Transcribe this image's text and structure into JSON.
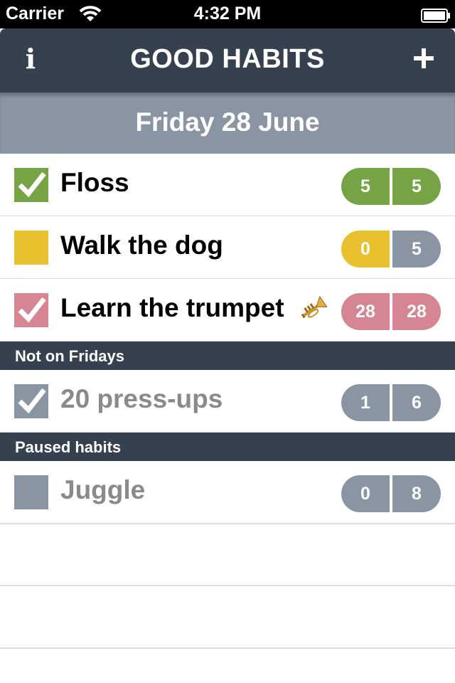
{
  "status_bar": {
    "carrier": "Carrier",
    "time": "4:32 PM"
  },
  "nav": {
    "title": "GOOD HABITS",
    "info_label": "i",
    "add_icon": "plus-icon",
    "info_icon": "info-icon"
  },
  "date_label": "Friday 28 June",
  "colors": {
    "dark": "#36414f",
    "date_bar": "#8a95a4",
    "green": "#76a445",
    "yellow": "#e9c12e",
    "pink": "#d68692",
    "gray": "#8a95a4"
  },
  "today_habits": [
    {
      "name": "Floss",
      "checked": true,
      "color": "green",
      "left_value": "5",
      "right_value": "5",
      "left_color": "green",
      "right_color": "green"
    },
    {
      "name": "Walk the dog",
      "checked": false,
      "color": "yellow",
      "left_value": "0",
      "right_value": "5",
      "left_color": "yellow",
      "right_color": "gray"
    },
    {
      "name": "Learn the trumpet",
      "checked": true,
      "color": "pink",
      "icon": "trumpet-icon",
      "left_value": "28",
      "right_value": "28",
      "left_color": "pink",
      "right_color": "pink"
    }
  ],
  "sections": {
    "not_today": "Not on Fridays",
    "paused": "Paused habits"
  },
  "not_today_habits": [
    {
      "name": "20 press-ups",
      "checked": true,
      "color": "gray",
      "left_value": "1",
      "right_value": "6",
      "left_color": "gray",
      "right_color": "gray"
    }
  ],
  "paused_habits": [
    {
      "name": "Juggle",
      "checked": false,
      "color": "gray",
      "left_value": "0",
      "right_value": "8",
      "left_color": "gray",
      "right_color": "gray"
    }
  ]
}
